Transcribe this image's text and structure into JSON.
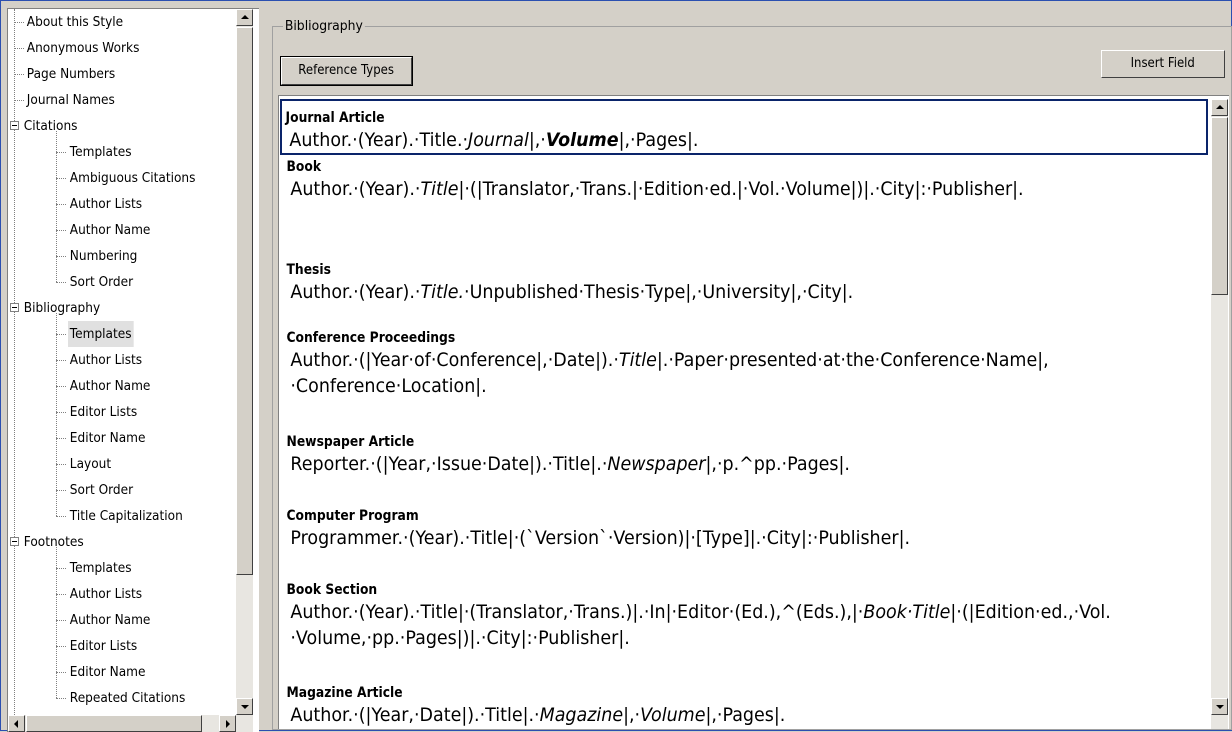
{
  "tree": {
    "items": [
      {
        "label": "About this Style",
        "level": 1
      },
      {
        "label": "Anonymous Works",
        "level": 1
      },
      {
        "label": "Page Numbers",
        "level": 1
      },
      {
        "label": "Journal Names",
        "level": 1
      },
      {
        "label": "Citations",
        "level": 0,
        "expanded": true
      },
      {
        "label": "Templates",
        "level": 2
      },
      {
        "label": "Ambiguous Citations",
        "level": 2
      },
      {
        "label": "Author Lists",
        "level": 2
      },
      {
        "label": "Author Name",
        "level": 2
      },
      {
        "label": "Numbering",
        "level": 2
      },
      {
        "label": "Sort Order",
        "level": 2
      },
      {
        "label": "Bibliography",
        "level": 0,
        "expanded": true
      },
      {
        "label": "Templates",
        "level": 2,
        "selected": true
      },
      {
        "label": "Author Lists",
        "level": 2
      },
      {
        "label": "Author Name",
        "level": 2
      },
      {
        "label": "Editor Lists",
        "level": 2
      },
      {
        "label": "Editor Name",
        "level": 2
      },
      {
        "label": "Layout",
        "level": 2
      },
      {
        "label": "Sort Order",
        "level": 2
      },
      {
        "label": "Title Capitalization",
        "level": 2
      },
      {
        "label": "Footnotes",
        "level": 0,
        "expanded": true
      },
      {
        "label": "Templates",
        "level": 2
      },
      {
        "label": "Author Lists",
        "level": 2
      },
      {
        "label": "Author Name",
        "level": 2
      },
      {
        "label": "Editor Lists",
        "level": 2
      },
      {
        "label": "Editor Name",
        "level": 2
      },
      {
        "label": "Repeated Citations",
        "level": 2
      }
    ]
  },
  "panel": {
    "group_title": "Bibliography",
    "reference_types_button": "Reference Types",
    "insert_field_button": "Insert Field"
  },
  "templates": [
    {
      "title": "Journal Article",
      "lines": [
        [
          [
            "Author.·(Year).·Title.·",
            ""
          ],
          [
            "Journal",
            "i"
          ],
          [
            "|,·",
            ""
          ],
          [
            "Volume",
            "bi"
          ],
          [
            "|,·Pages|.",
            ""
          ]
        ]
      ],
      "active": true
    },
    {
      "title": "Book",
      "lines": [
        [
          [
            "Author.·(Year).·",
            ""
          ],
          [
            "Title",
            "i"
          ],
          [
            "|·(|Translator,·Trans.|·Edition·ed.|·Vol.·Volume|)|.·City|:·Publisher|.",
            ""
          ]
        ]
      ]
    },
    {
      "title": "Thesis",
      "lines": [
        [
          [
            "Author.·(Year).·",
            ""
          ],
          [
            "Title.",
            "i"
          ],
          [
            "·Unpublished·Thesis·Type|,·University|,·City|.",
            ""
          ]
        ]
      ]
    },
    {
      "title": "Conference Proceedings",
      "lines": [
        [
          [
            "Author.·(|Year·of·Conference|,·Date|).·",
            ""
          ],
          [
            "Title",
            "i"
          ],
          [
            "|.·Paper·presented·at·the·Conference·Name|,",
            ""
          ]
        ],
        [
          [
            "·Conference·Location|.",
            ""
          ]
        ]
      ]
    },
    {
      "title": "Newspaper Article",
      "lines": [
        [
          [
            "Reporter.·(|Year,·Issue·Date|).·Title|.·",
            ""
          ],
          [
            "Newspaper",
            "i"
          ],
          [
            "|,·p.^pp.·Pages|.",
            ""
          ]
        ]
      ]
    },
    {
      "title": "Computer Program",
      "lines": [
        [
          [
            "Programmer.·(Year).·Title|·(`Version`·Version)|·[Type]|.·City|:·Publisher|.",
            ""
          ]
        ]
      ]
    },
    {
      "title": "Book Section",
      "lines": [
        [
          [
            "Author.·(Year).·Title|·(Translator,·Trans.)|.·In|·Editor·(Ed.),^(Eds.),|·",
            ""
          ],
          [
            "Book·Title",
            "i"
          ],
          [
            "|·(|Edition·ed.,·Vol.",
            ""
          ]
        ],
        [
          [
            "·Volume,·pp.·Pages|)|.·City|:·Publisher|.",
            ""
          ]
        ]
      ]
    },
    {
      "title": "Magazine Article",
      "lines": [
        [
          [
            "Author.·(|Year,·Date|).·Title|.·",
            ""
          ],
          [
            "Magazine",
            "i"
          ],
          [
            "|,·",
            ""
          ],
          [
            "Volume",
            "i"
          ],
          [
            "|,·Pages|.",
            ""
          ]
        ]
      ]
    }
  ]
}
